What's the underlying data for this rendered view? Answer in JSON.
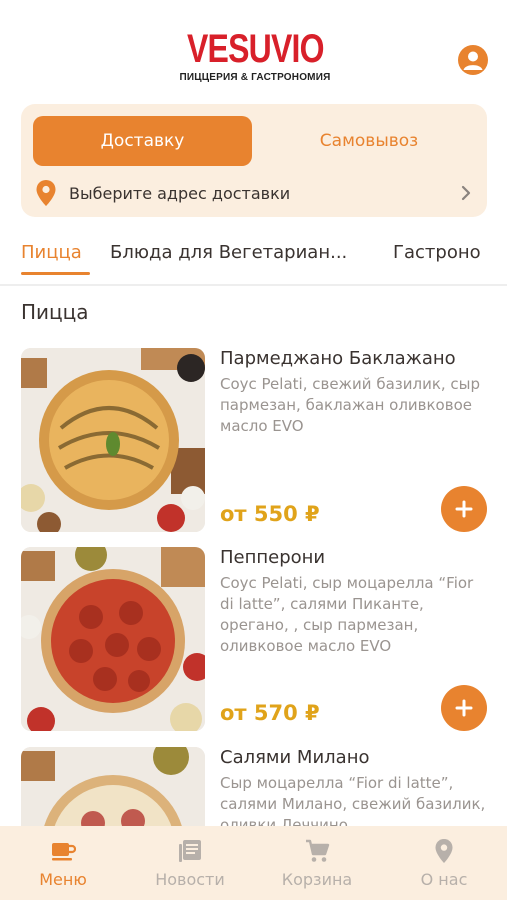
{
  "brand": {
    "logo_text": "VESUVIO",
    "logo_subtitle": "ПИЦЦЕРИЯ & ГАСТРОНОМИЯ",
    "accent_color": "#e8832f",
    "logo_color": "#d8202a",
    "price_color": "#e0a31a"
  },
  "delivery": {
    "tab_delivery": "Доставку",
    "tab_pickup": "Самовывоз",
    "selected_tab": "Доставку",
    "address_placeholder": "Выберите адрес доставки"
  },
  "categories": [
    {
      "label": "Пицца",
      "active": true
    },
    {
      "label": "Блюда для Вегетариан...",
      "active": false
    },
    {
      "label": "Гастроно",
      "active": false
    }
  ],
  "section_title": "Пицца",
  "products": [
    {
      "name": "Пармеджано Баклажано",
      "description": "Соус Pelati, свежий базилик, сыр пармезан, баклажан оливковое масло EVO",
      "price": "от 550 ₽"
    },
    {
      "name": "Пепперони",
      "description": "Соус Pelati, сыр моцарелла “Fior di latte”, салями Пиканте, орегано, , сыр пармезан, оливковое масло EVO",
      "price": "от 570 ₽"
    },
    {
      "name": "Салями Милано",
      "description": "Сыр моцарелла “Fior di latte”, салями Милано, свежий базилик, оливки Леччино",
      "price": ""
    }
  ],
  "bottom_nav": [
    {
      "label": "Меню",
      "icon": "cup-icon",
      "active": true
    },
    {
      "label": "Новости",
      "icon": "news-icon",
      "active": false
    },
    {
      "label": "Корзина",
      "icon": "cart-icon",
      "active": false
    },
    {
      "label": "О нас",
      "icon": "location-icon",
      "active": false
    }
  ]
}
